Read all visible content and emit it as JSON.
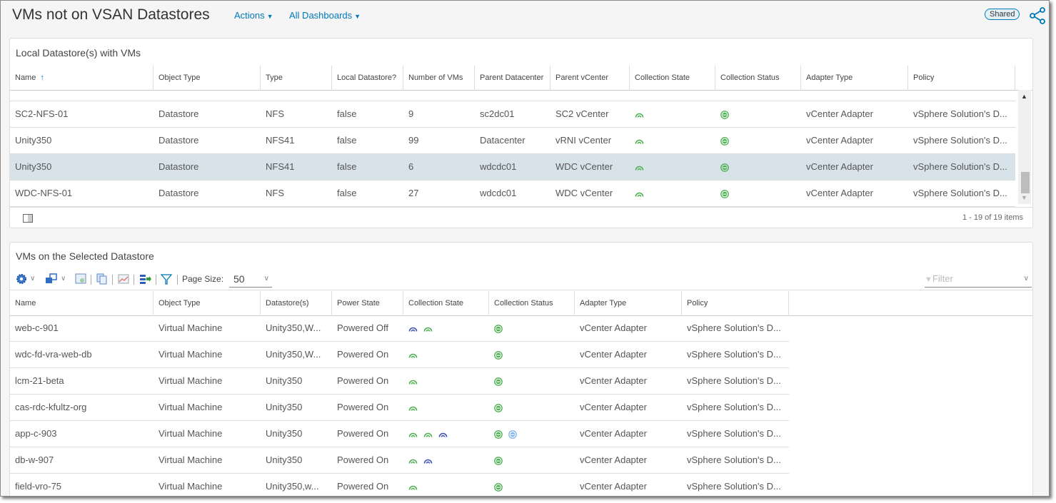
{
  "header": {
    "title": "VMs not on VSAN Datastores",
    "actions_label": "Actions",
    "dashboards_label": "All Dashboards",
    "shared_badge": "Shared"
  },
  "colors": {
    "accent": "#0079b8",
    "ok_green": "#4caf50",
    "blue_state": "#3f51b5",
    "selected_row": "#d8e3e9"
  },
  "top_panel": {
    "title": "Local Datastore(s) with VMs",
    "columns": [
      "Name",
      "Object Type",
      "Type",
      "Local Datastore?",
      "Number of VMs",
      "Parent Datacenter",
      "Parent vCenter",
      "Collection State",
      "Collection Status",
      "Adapter Type",
      "Policy"
    ],
    "sort": "ascending",
    "rows": [
      {
        "cells": [
          "SC2-NFS-01",
          "Datastore",
          "NFS",
          "false",
          "9",
          "sc2dc01",
          "SC2 vCenter"
        ],
        "state": [
          "green"
        ],
        "status": [
          "green"
        ],
        "adapter": "vCenter Adapter",
        "policy": "vSphere Solution's D..."
      },
      {
        "cells": [
          "Unity350",
          "Datastore",
          "NFS41",
          "false",
          "99",
          "Datacenter",
          "vRNI vCenter"
        ],
        "state": [
          "green"
        ],
        "status": [
          "green"
        ],
        "adapter": "vCenter Adapter",
        "policy": "vSphere Solution's D..."
      },
      {
        "cells": [
          "Unity350",
          "Datastore",
          "NFS41",
          "false",
          "6",
          "wdcdc01",
          "WDC vCenter"
        ],
        "state": [
          "green"
        ],
        "status": [
          "green"
        ],
        "adapter": "vCenter Adapter",
        "policy": "vSphere Solution's D...",
        "selected": true
      },
      {
        "cells": [
          "WDC-NFS-01",
          "Datastore",
          "NFS",
          "false",
          "27",
          "wdcdc01",
          "WDC vCenter"
        ],
        "state": [
          "green"
        ],
        "status": [
          "green"
        ],
        "adapter": "vCenter Adapter",
        "policy": "vSphere Solution's D..."
      }
    ],
    "footer": "1 - 19 of 19 items"
  },
  "bottom_panel": {
    "title": "VMs on the Selected Datastore",
    "page_size_label": "Page Size:",
    "page_size": "50",
    "filter_placeholder": "Filter",
    "columns": [
      "Name",
      "Object Type",
      "Datastore(s)",
      "Power State",
      "Collection State",
      "Collection Status",
      "Adapter Type",
      "Policy"
    ],
    "rows": [
      {
        "cells": [
          "web-c-901",
          "Virtual Machine",
          "Unity350,W...",
          "Powered Off"
        ],
        "state": [
          "blue",
          "green"
        ],
        "status": [
          "green"
        ],
        "adapter": "vCenter Adapter",
        "policy": "vSphere Solution's D..."
      },
      {
        "cells": [
          "wdc-fd-vra-web-db",
          "Virtual Machine",
          "Unity350,W...",
          "Powered On"
        ],
        "state": [
          "green"
        ],
        "status": [
          "green"
        ],
        "adapter": "vCenter Adapter",
        "policy": "vSphere Solution's D..."
      },
      {
        "cells": [
          "lcm-21-beta",
          "Virtual Machine",
          "Unity350",
          "Powered On"
        ],
        "state": [
          "green"
        ],
        "status": [
          "green"
        ],
        "adapter": "vCenter Adapter",
        "policy": "vSphere Solution's D..."
      },
      {
        "cells": [
          "cas-rdc-kfultz-org",
          "Virtual Machine",
          "Unity350",
          "Powered On"
        ],
        "state": [
          "green"
        ],
        "status": [
          "green"
        ],
        "adapter": "vCenter Adapter",
        "policy": "vSphere Solution's D..."
      },
      {
        "cells": [
          "app-c-903",
          "Virtual Machine",
          "Unity350",
          "Powered On"
        ],
        "state": [
          "green",
          "green",
          "blue"
        ],
        "status": [
          "green",
          "lightblue"
        ],
        "adapter": "vCenter Adapter",
        "policy": "vSphere Solution's D..."
      },
      {
        "cells": [
          "db-w-907",
          "Virtual Machine",
          "Unity350",
          "Powered On"
        ],
        "state": [
          "green",
          "blue"
        ],
        "status": [
          "green"
        ],
        "adapter": "vCenter Adapter",
        "policy": "vSphere Solution's D..."
      },
      {
        "cells": [
          "field-vro-75",
          "Virtual Machine",
          "Unity350,w...",
          "Powered On"
        ],
        "state": [
          "green"
        ],
        "status": [
          "green"
        ],
        "adapter": "vCenter Adapter",
        "policy": "vSphere Solution's D..."
      }
    ]
  }
}
